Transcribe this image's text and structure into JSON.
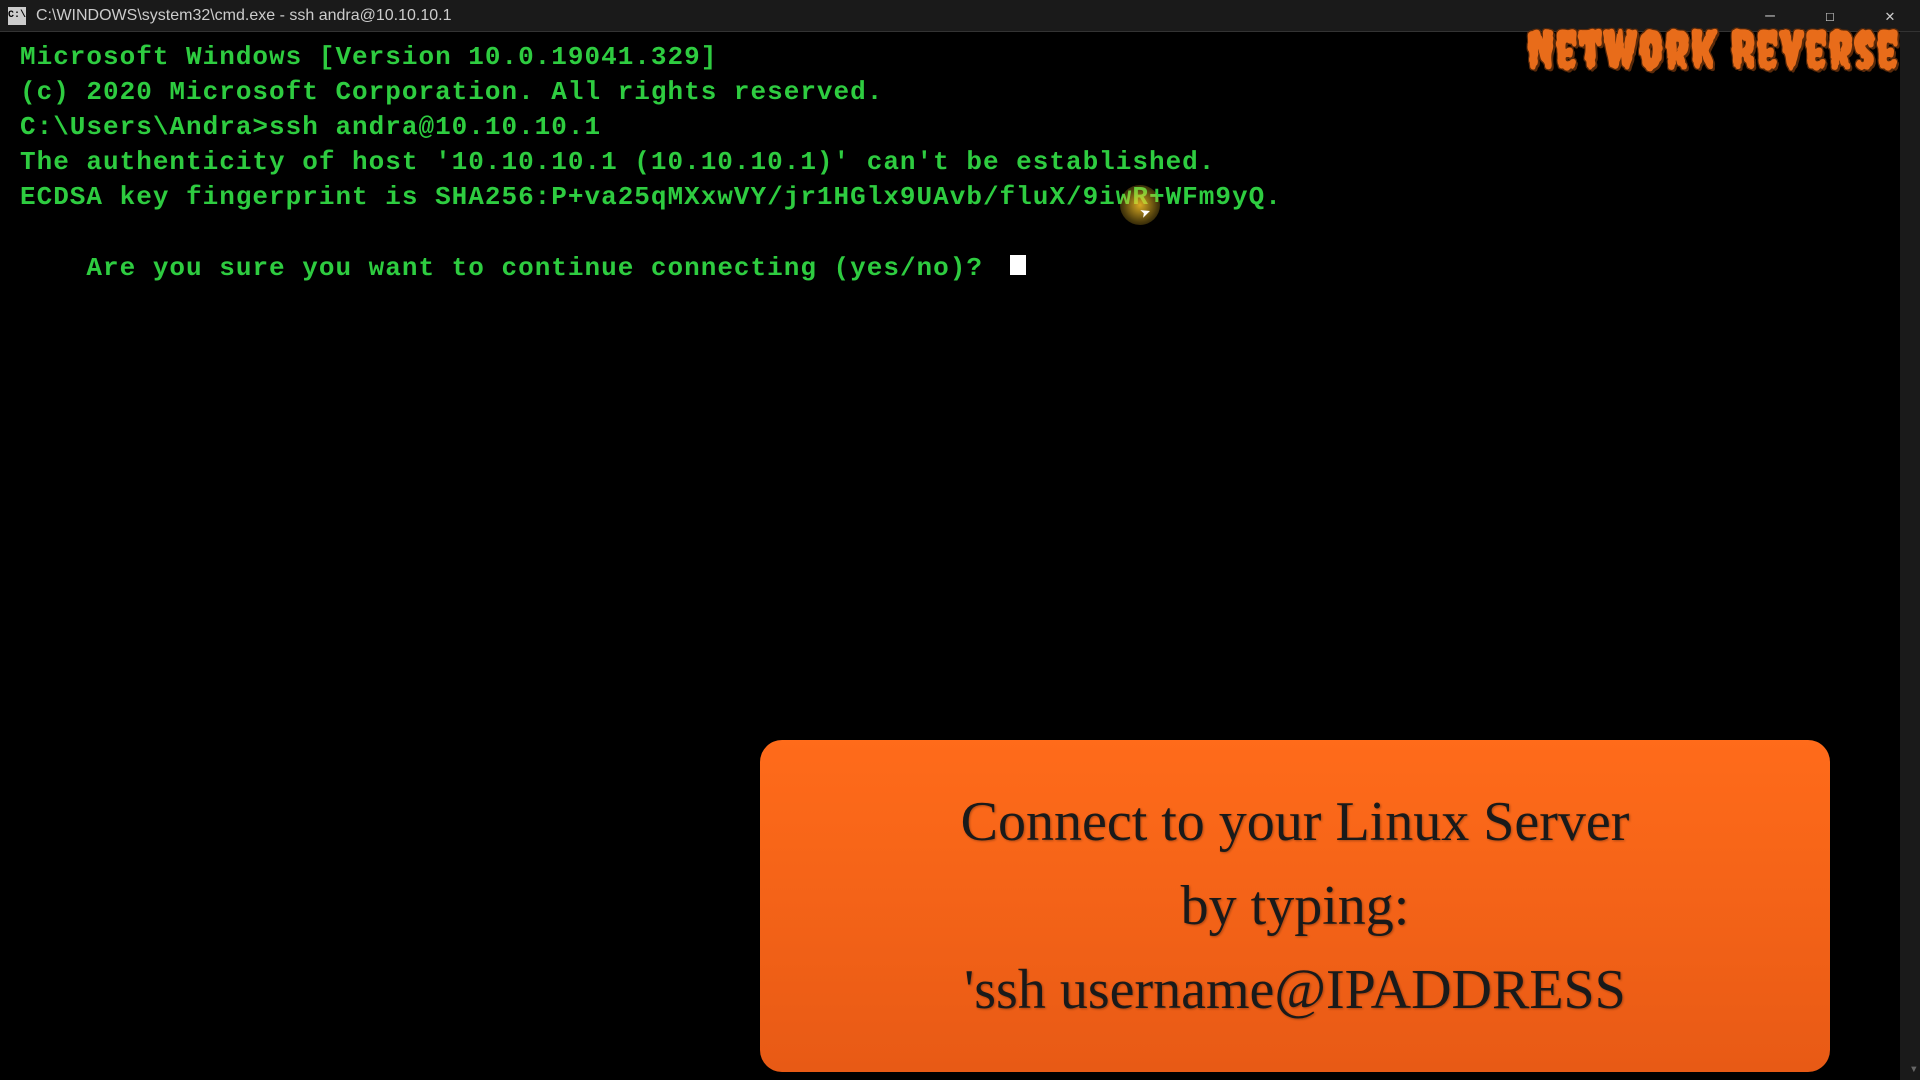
{
  "titlebar": {
    "icon_label": "cmd",
    "title": "C:\\WINDOWS\\system32\\cmd.exe - ssh  andra@10.10.10.1"
  },
  "window_controls": {
    "minimize": "—",
    "maximize": "☐",
    "close": "✕"
  },
  "terminal": {
    "line1": "Microsoft Windows [Version 10.0.19041.329]",
    "line2": "(c) 2020 Microsoft Corporation. All rights reserved.",
    "blank1": "",
    "prompt_line": "C:\\Users\\Andra>ssh andra@10.10.10.1",
    "auth_line": "The authenticity of host '10.10.10.1 (10.10.10.1)' can't be established.",
    "ecdsa_line": "ECDSA key fingerprint is SHA256:P+va25qMXxwVY/jr1HGlx9UAvb/fluX/9iwR+WFm9yQ.",
    "confirm_line": "Are you sure you want to continue connecting (yes/no)? "
  },
  "watermark": {
    "text": "Network Reverse"
  },
  "tooltip": {
    "line1": "Connect to your Linux Server",
    "line2": "by typing:",
    "line3": "'ssh username@IPADDRESS"
  }
}
